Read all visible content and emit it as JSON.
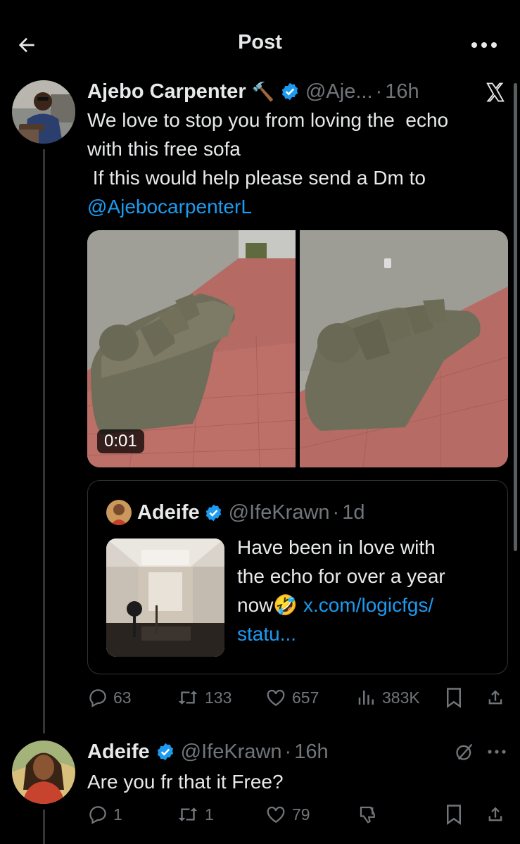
{
  "header": {
    "title": "Post"
  },
  "main_post": {
    "author_name": "Ajebo Carpenter",
    "author_emoji": "🔨",
    "author_handle": "@Aje...",
    "separator": "·",
    "time": "16h",
    "text_line1": "We love to stop you from loving the  echo",
    "text_line2": "with this free sofa",
    "text_line3": " If this would help please send a Dm to",
    "mention": "@AjebocarpenterL",
    "video_duration": "0:01",
    "quote": {
      "author_name": "Adeife",
      "author_handle": "@IfeKrawn",
      "separator": "·",
      "time": "1d",
      "text_line1": "Have been in love with",
      "text_line2": "the echo for over a year",
      "text_line3_prefix": "now",
      "text_line3_emoji": "🤣",
      "link_line1": "x.com/logicfgs/",
      "link_line2": "statu..."
    },
    "stats": {
      "replies": "63",
      "reposts": "133",
      "likes": "657",
      "views": "383K"
    }
  },
  "reply": {
    "author_name": "Adeife",
    "author_handle": "@IfeKrawn",
    "separator": "·",
    "time": "16h",
    "text": "Are you fr that it Free?",
    "stats": {
      "replies": "1",
      "reposts": "1",
      "likes": "79"
    }
  },
  "icons": {
    "back": "arrow-left-icon",
    "more": "more-horizontal-icon",
    "verified": "verified-badge-icon",
    "grok": "grok-icon",
    "reply": "reply-icon",
    "repost": "repost-icon",
    "like": "heart-icon",
    "views": "views-icon",
    "bookmark": "bookmark-icon",
    "share": "share-icon",
    "dislike": "dislike-icon"
  },
  "colors": {
    "background": "#000000",
    "text": "#e7e9ea",
    "secondary": "#71767b",
    "link": "#1d9bf0",
    "verified": "#1d9bf0"
  }
}
